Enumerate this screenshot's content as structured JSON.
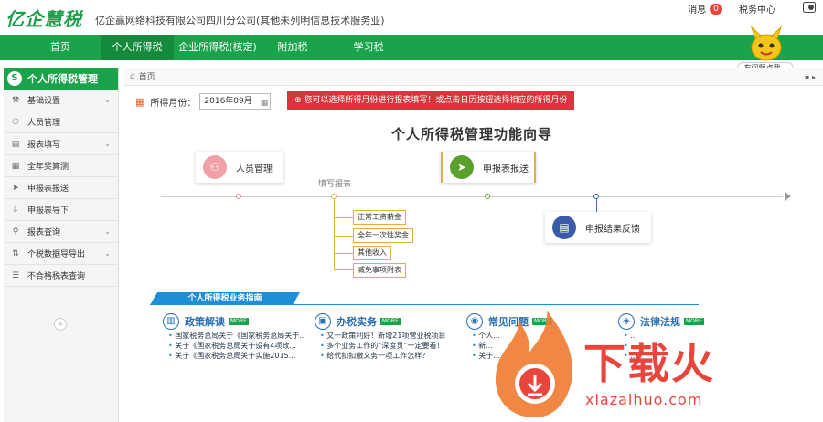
{
  "brand": {
    "logo_text": "亿企慧税",
    "company": "亿企赢网络科技有限公司四川分公司(其他未列明信息技术服务业)"
  },
  "top_right": {
    "messages_label": "消息",
    "messages_count": "0",
    "tax_center_label": "税务中心"
  },
  "nav": {
    "items": [
      {
        "label": "首页"
      },
      {
        "label": "个人所得税"
      },
      {
        "label": "企业所得税(核定)"
      },
      {
        "label": "附加税"
      },
      {
        "label": "学习税"
      }
    ],
    "active_index": 1
  },
  "mascot": {
    "bubble_text": "有问题点我~"
  },
  "sidebar": {
    "title": "个人所得税管理",
    "items": [
      {
        "label": "基础设置",
        "icon": "wrench-icon",
        "has_children": true
      },
      {
        "label": "人员管理",
        "icon": "person-icon",
        "has_children": false
      },
      {
        "label": "报表填写",
        "icon": "form-icon",
        "has_children": true
      },
      {
        "label": "全年奖算测",
        "icon": "calculator-icon",
        "has_children": false
      },
      {
        "label": "申报表报送",
        "icon": "send-icon",
        "has_children": false
      },
      {
        "label": "申报表导下",
        "icon": "download-icon",
        "has_children": false
      },
      {
        "label": "报表查询",
        "icon": "search-icon",
        "has_children": true
      },
      {
        "label": "个税数据导导出",
        "icon": "transfer-icon",
        "has_children": true
      },
      {
        "label": "不合格税表查询",
        "icon": "list-icon",
        "has_children": false
      }
    ]
  },
  "breadcrumb": {
    "home": "首页"
  },
  "month": {
    "label": "所得月份：",
    "value": "2016年09月",
    "notice": "您可以选择所得月份进行报表填写！或点击日历按钮选择相应的所得月份"
  },
  "guide": {
    "title": "个人所得税管理功能向导",
    "steps": [
      {
        "label": "人员管理",
        "color": "#f0a0a8",
        "icon": "person-icon"
      },
      {
        "label": "申报表报送",
        "color": "#5aa02c",
        "icon": "send-icon"
      },
      {
        "label": "申报结果反馈",
        "color": "#3a5ba8",
        "icon": "feedback-icon"
      }
    ],
    "branch_label": "填写报表",
    "branch_items": [
      "正常工资薪金",
      "全年一次性奖金",
      "其他收入",
      "减免事项附表"
    ]
  },
  "business": {
    "title": "个人所得税业务指南",
    "more_label": "MORE",
    "columns": [
      {
        "title": "政策解读",
        "icon": "book-icon",
        "links": [
          "国家税务总局关于《国家税务总局关于...",
          "关于《国家税务总局关于设有4项政...",
          "关于《国家税务总局关于实施2015..."
        ]
      },
      {
        "title": "办税实务",
        "icon": "briefcase-icon",
        "links": [
          "又一政策利好！新增21项营业税项目",
          "多个业务工作的“深度贯”一定要看！",
          "给代扣扣缴义务一项工作怎样？"
        ]
      },
      {
        "title": "常见问题",
        "icon": "piggy-icon",
        "links": [
          "个人...",
          "新...",
          "关于..."
        ]
      },
      {
        "title": "法律法规",
        "icon": "shield-icon",
        "links": [
          "...",
          "...",
          "..."
        ]
      }
    ]
  },
  "watermark": {
    "text": "下载火",
    "url": "xiazaihuo.com"
  },
  "colors": {
    "brand_green": "#1aa34a",
    "notice_red": "#d9353c",
    "link_blue": "#1e8fd6",
    "watermark_red": "#e8453c"
  }
}
